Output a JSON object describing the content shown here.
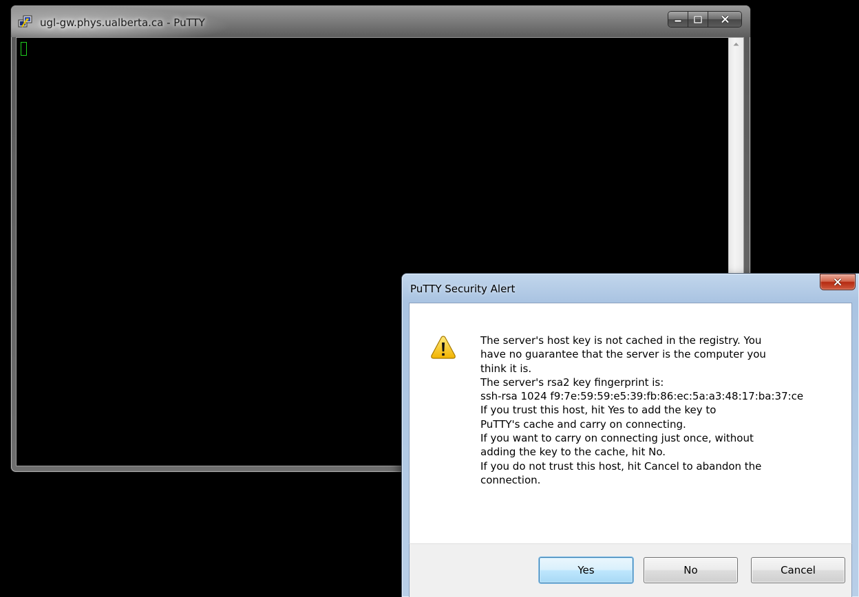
{
  "putty_window": {
    "title": "ugl-gw.phys.ualberta.ca - PuTTY",
    "icon": "putty-app-icon",
    "controls": {
      "minimize_icon": "minimize-icon",
      "maximize_icon": "maximize-icon",
      "close_icon": "close-icon"
    },
    "terminal": {
      "cursor_color": "#1fd01f",
      "background": "#000000"
    }
  },
  "security_alert": {
    "title": "PuTTY Security Alert",
    "icon": "warning-icon",
    "message_lines": [
      "The server's host key is not cached in the registry. You",
      "have no guarantee that the server is the computer you",
      "think it is.",
      "The server's rsa2 key fingerprint is:",
      "ssh-rsa 1024 f9:7e:59:59:e5:39:fb:86:ec:5a:a3:48:17:ba:37:ce",
      "If you trust this host, hit Yes to add the key to",
      "PuTTY's cache and carry on connecting.",
      "If you want to carry on connecting just once, without",
      "adding the key to the cache, hit No.",
      "If you do not trust this host, hit Cancel to abandon the",
      "connection."
    ],
    "buttons": {
      "yes": "Yes",
      "no": "No",
      "cancel": "Cancel"
    },
    "close_color": "#c9432a"
  }
}
